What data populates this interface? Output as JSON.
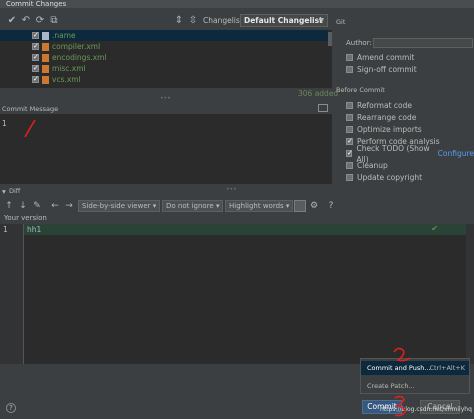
{
  "window": {
    "title": "Commit Changes"
  },
  "toolbar": {
    "icons": [
      "commit-icon",
      "undo-icon",
      "refresh-icon",
      "diff-icon",
      "expand-icon",
      "collapse-icon"
    ],
    "changelist_label": "Changelist:",
    "changelist_value": "Default Changelist"
  },
  "files": {
    "root": ".name",
    "items": [
      ".name",
      "compiler.xml",
      "encodings.xml",
      "misc.xml",
      "vcs.xml"
    ],
    "added_count": "306 added"
  },
  "git": {
    "section": "Git",
    "author_label": "Author:",
    "amend": "Amend commit",
    "signoff": "Sign-off commit"
  },
  "before_commit": {
    "section": "Before Commit",
    "options": [
      {
        "label": "Reformat code",
        "checked": false
      },
      {
        "label": "Rearrange code",
        "checked": false
      },
      {
        "label": "Optimize imports",
        "checked": false
      },
      {
        "label": "Perform code analysis",
        "checked": true
      },
      {
        "label": "Check TODO (Show All)",
        "checked": true
      },
      {
        "label": "Cleanup",
        "checked": false
      },
      {
        "label": "Update copyright",
        "checked": false
      }
    ],
    "configure_link": "Configure"
  },
  "commit_message": {
    "label": "Commit Message",
    "line_number": "1"
  },
  "diff": {
    "label": "Diff",
    "viewer": "Side-by-side viewer",
    "whitespace": "Do not ignore",
    "highlight": "Highlight words",
    "help": "?",
    "your_version": "Your version",
    "line_number": "1",
    "line_text": "hh1"
  },
  "popup": {
    "commit_push": "Commit and Push...",
    "commit_push_shortcut": "Ctrl+Alt+K",
    "create_patch": "Create Patch..."
  },
  "buttons": {
    "commit": "Commit",
    "cancel": "Cancel",
    "help": "?"
  },
  "watermark": "https://blog.csdn.net/xhmilyhq",
  "colors": {
    "background": "#3c3f41",
    "editor": "#2b2b2b",
    "selection": "#0d293e",
    "added_line": "#294436",
    "file_added": "#6a9955",
    "primary_button": "#365880",
    "annotation": "#e0201c"
  }
}
